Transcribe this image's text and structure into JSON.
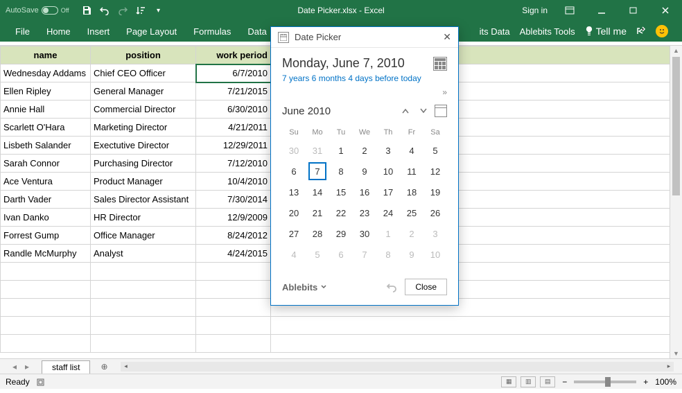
{
  "titlebar": {
    "autosave_label": "AutoSave",
    "autosave_state": "Off",
    "title": "Date Picker.xlsx - Excel",
    "signin": "Sign in"
  },
  "ribbon": {
    "tabs": [
      "File",
      "Home",
      "Insert",
      "Page Layout",
      "Formulas",
      "Data"
    ],
    "right_tabs": [
      "its Data",
      "Ablebits Tools"
    ],
    "tellme": "Tell me"
  },
  "table": {
    "headers": [
      "name",
      "position",
      "work period"
    ],
    "rows": [
      {
        "name": "Wednesday Addams",
        "position": "Chief CEO Officer",
        "date": "6/7/2010"
      },
      {
        "name": "Ellen Ripley",
        "position": "General Manager",
        "date": "7/21/2015"
      },
      {
        "name": "Annie Hall",
        "position": "Commercial Director",
        "date": "6/30/2010"
      },
      {
        "name": "Scarlett O'Hara",
        "position": "Marketing Director",
        "date": "4/21/2011"
      },
      {
        "name": "Lisbeth Salander",
        "position": "Exectutive Director",
        "date": "12/29/2011"
      },
      {
        "name": "Sarah Connor",
        "position": "Purchasing Director",
        "date": "7/12/2010"
      },
      {
        "name": "Ace Ventura",
        "position": "Product Manager",
        "date": "10/4/2010"
      },
      {
        "name": "Darth Vader",
        "position": "Sales Director Assistant",
        "date": "7/30/2014"
      },
      {
        "name": "Ivan Danko",
        "position": "HR Director",
        "date": "12/9/2009"
      },
      {
        "name": "Forrest Gump",
        "position": "Office Manager",
        "date": "8/24/2012"
      },
      {
        "name": "Randle McMurphy",
        "position": "Analyst",
        "date": "4/24/2015"
      }
    ]
  },
  "sheet_tab": "staff list",
  "status": {
    "ready": "Ready",
    "zoom": "100%"
  },
  "popup": {
    "title": "Date Picker",
    "full_date": "Monday, June 7, 2010",
    "relative": "7 years 6 months 4 days before today",
    "month_label": "June 2010",
    "dow": [
      "Su",
      "Mo",
      "Tu",
      "We",
      "Th",
      "Fr",
      "Sa"
    ],
    "weeks": [
      [
        {
          "d": 30,
          "o": true
        },
        {
          "d": 31,
          "o": true
        },
        {
          "d": 1
        },
        {
          "d": 2
        },
        {
          "d": 3
        },
        {
          "d": 4
        },
        {
          "d": 5
        }
      ],
      [
        {
          "d": 6
        },
        {
          "d": 7,
          "sel": true
        },
        {
          "d": 8
        },
        {
          "d": 9
        },
        {
          "d": 10
        },
        {
          "d": 11
        },
        {
          "d": 12
        }
      ],
      [
        {
          "d": 13
        },
        {
          "d": 14
        },
        {
          "d": 15
        },
        {
          "d": 16
        },
        {
          "d": 17
        },
        {
          "d": 18
        },
        {
          "d": 19
        }
      ],
      [
        {
          "d": 20
        },
        {
          "d": 21
        },
        {
          "d": 22
        },
        {
          "d": 23
        },
        {
          "d": 24
        },
        {
          "d": 25
        },
        {
          "d": 26
        }
      ],
      [
        {
          "d": 27
        },
        {
          "d": 28
        },
        {
          "d": 29
        },
        {
          "d": 30
        },
        {
          "d": 1,
          "o": true
        },
        {
          "d": 2,
          "o": true
        },
        {
          "d": 3,
          "o": true
        }
      ],
      [
        {
          "d": 4,
          "o": true
        },
        {
          "d": 5,
          "o": true
        },
        {
          "d": 6,
          "o": true
        },
        {
          "d": 7,
          "o": true
        },
        {
          "d": 8,
          "o": true
        },
        {
          "d": 9,
          "o": true
        },
        {
          "d": 10,
          "o": true
        }
      ]
    ],
    "brand": "Ablebits",
    "close": "Close"
  }
}
